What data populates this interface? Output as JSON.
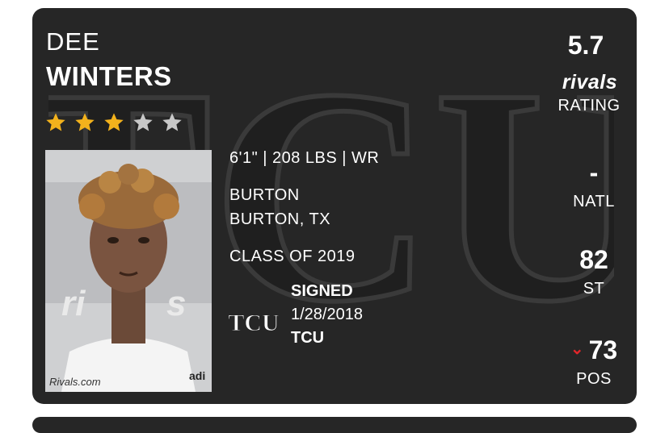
{
  "player": {
    "first_name": "DEE",
    "last_name": "WINTERS",
    "stars_filled": 3,
    "stars_total": 5,
    "measurables": "6'1\" | 208 LBS | WR",
    "high_school": "BURTON",
    "hometown": "BURTON, TX",
    "class": "CLASS OF 2019",
    "photo_credit": "Rivals.com"
  },
  "commitment": {
    "status": "SIGNED",
    "date": "1/28/2018",
    "school": "TCU",
    "logo_text": "TCU",
    "background_logo_text": "TCU"
  },
  "ratings": {
    "rating_value": "5.7",
    "rating_brand": "rivals",
    "rating_label": "RATING",
    "natl_value": "-",
    "natl_label": "NATL",
    "state_value": "82",
    "state_label": "ST",
    "pos_value": "73",
    "pos_label": "POS",
    "pos_trend_icon": "chevron-down-icon"
  },
  "colors": {
    "card_bg": "#262626",
    "star_filled": "#f3b21c",
    "star_empty": "#c8c8c8",
    "trend_down": "#e0262a"
  }
}
